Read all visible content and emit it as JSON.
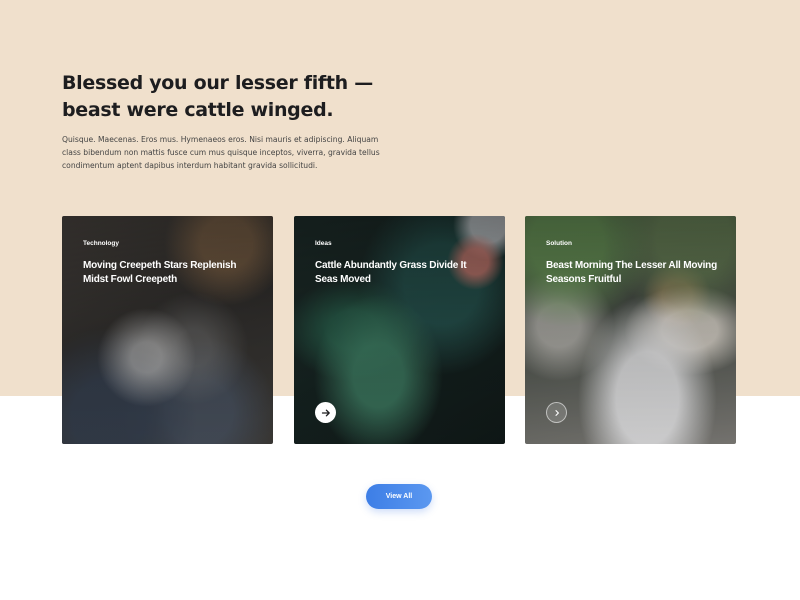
{
  "colors": {
    "beige_background": "#f0e0cc",
    "heading_text": "#1d1d1f",
    "body_text": "#444444",
    "button_gradient_start": "#3d7ee6",
    "button_gradient_end": "#5b98f0"
  },
  "intro": {
    "heading_line1": "Blessed you our lesser fifth —",
    "heading_line2": "beast were cattle winged.",
    "paragraph": "Quisque. Maecenas. Eros mus. Hymenaeos eros. Nisi mauris et adipiscing. Aliquam class bibendum non mattis fusce cum mus quisque inceptos, viverra, gravida tellus condimentum aptent dapibus interdum habitant gravida sollicitudi."
  },
  "cards": [
    {
      "category": "Technology",
      "title": "Moving Creepeth Stars Replenish Midst Fowl Creepeth",
      "icon": "arrow-right-icon"
    },
    {
      "category": "Ideas",
      "title": "Cattle Abundantly Grass Divide It Seas Moved",
      "icon": "arrow-right-icon"
    },
    {
      "category": "Solution",
      "title": "Beast Morning The Lesser All Moving Seasons Fruitful",
      "icon": "chevron-right-icon"
    }
  ],
  "actions": {
    "view_all_label": "View All"
  }
}
